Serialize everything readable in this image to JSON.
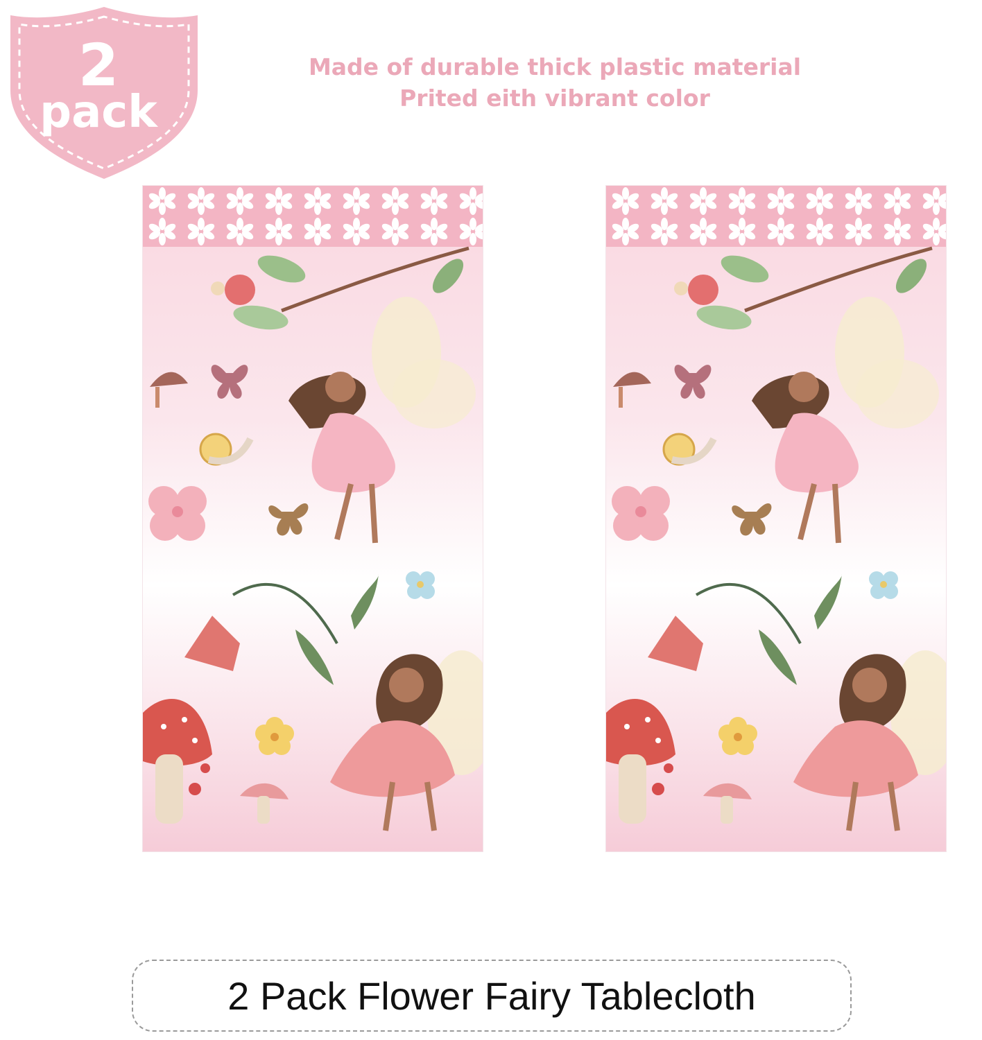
{
  "badge": {
    "number": "2",
    "word": "pack",
    "color": "#f2b8c6"
  },
  "features": {
    "line1": "Made of durable thick plastic material",
    "line2": "Prited eith vibrant color",
    "color": "#eba8b8"
  },
  "products": [
    {
      "name": "tablecloth-left",
      "border_color": "#f3b5c4"
    },
    {
      "name": "tablecloth-right",
      "border_color": "#f3b5c4"
    }
  ],
  "caption": "2 Pack Flower Fairy Tablecloth"
}
